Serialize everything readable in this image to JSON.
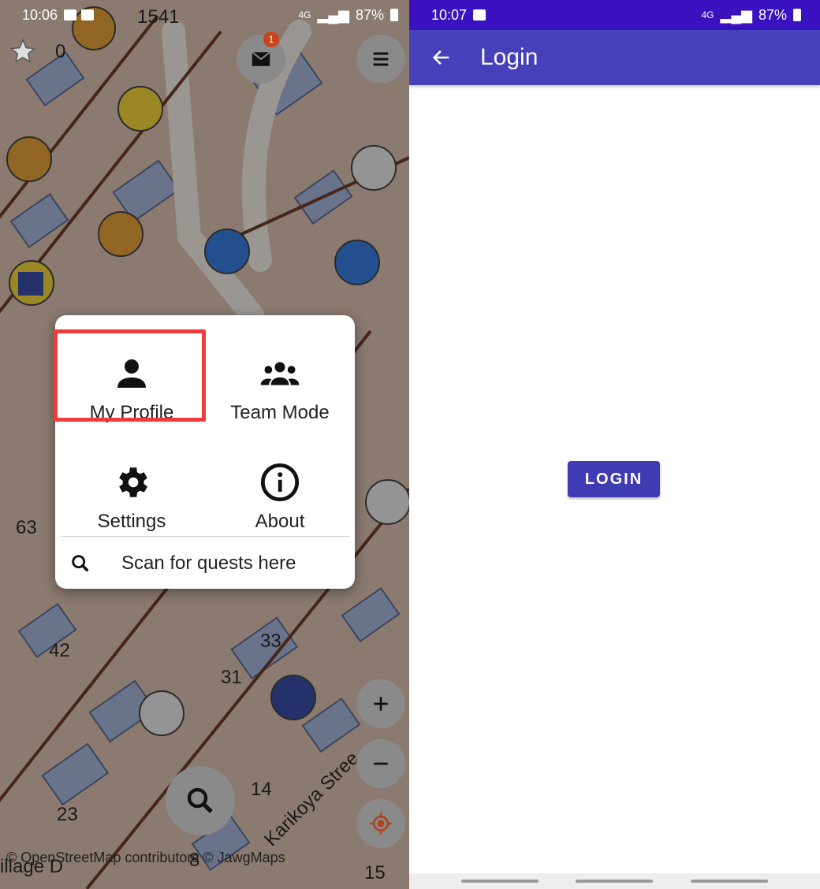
{
  "left": {
    "status_bar": {
      "time": "10:06",
      "network": "4G",
      "battery": "87%"
    },
    "map": {
      "labels": [
        "1541",
        "0",
        "63",
        "42",
        "33",
        "31",
        "14",
        "23",
        "15",
        "8"
      ],
      "street": "Karikoya Stree",
      "place": "illage D",
      "attribution": "© OpenStreetMap contributors  © JawgMaps"
    },
    "mail_badge": "1",
    "menu": {
      "items": [
        {
          "label": "My Profile",
          "icon": "person-icon"
        },
        {
          "label": "Team Mode",
          "icon": "group-icon"
        },
        {
          "label": "Settings",
          "icon": "gear-icon"
        },
        {
          "label": "About",
          "icon": "info-icon"
        }
      ],
      "scan_label": "Scan for quests here"
    }
  },
  "right": {
    "status_bar": {
      "time": "10:07",
      "network": "4G",
      "battery": "87%"
    },
    "app_bar": {
      "title": "Login"
    },
    "login_button": "LOGIN"
  },
  "colors": {
    "app_bar": "#4740bb",
    "status_bar": "#3a12bf",
    "button": "#3f3bb2",
    "highlight": "#ef3b3b"
  }
}
